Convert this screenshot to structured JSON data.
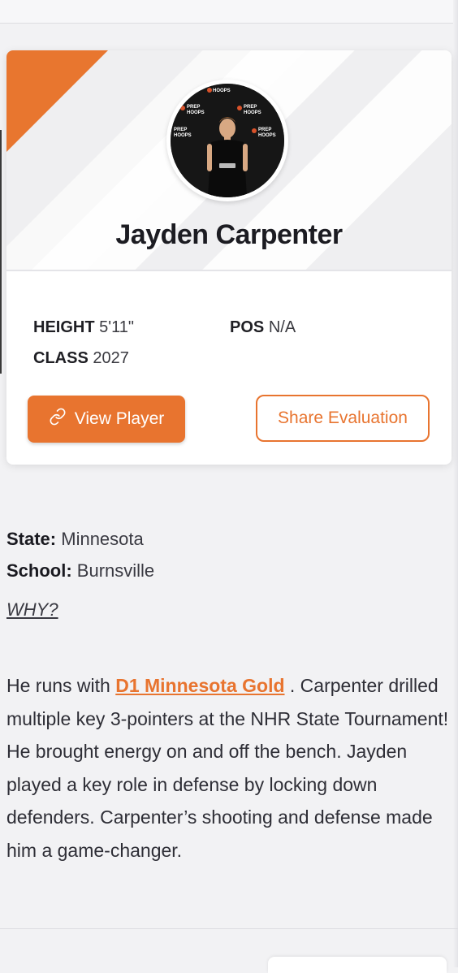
{
  "player": {
    "name": "Jayden Carpenter",
    "height_label": "HEIGHT",
    "height_value": "5'11\"",
    "pos_label": "POS",
    "pos_value": "N/A",
    "class_label": "CLASS",
    "class_value": "2027"
  },
  "actions": {
    "view_player": "View Player",
    "share_evaluation": "Share Evaluation"
  },
  "photo_banner": {
    "brand_prep": "PREP",
    "brand_hoops": "HOOPS"
  },
  "details": {
    "state_label": "State:",
    "state_value": "Minnesota",
    "school_label": "School:",
    "school_value": "Burnsville"
  },
  "why_heading": "WHY?",
  "evaluation": {
    "intro": "He runs with",
    "team_link": "D1 Minnesota Gold",
    "body": " . Carpenter drilled multiple key 3-pointers at the NHR State Tournament! He brought energy on and off the bench. Jayden played a key role in defense by locking down defenders. Carpenter’s shooting and defense made him a game-changer."
  },
  "colors": {
    "accent": "#e8742f",
    "text": "#1e1e24",
    "background": "#f2f2f4"
  },
  "icons": {
    "view_player": "link-icon"
  }
}
